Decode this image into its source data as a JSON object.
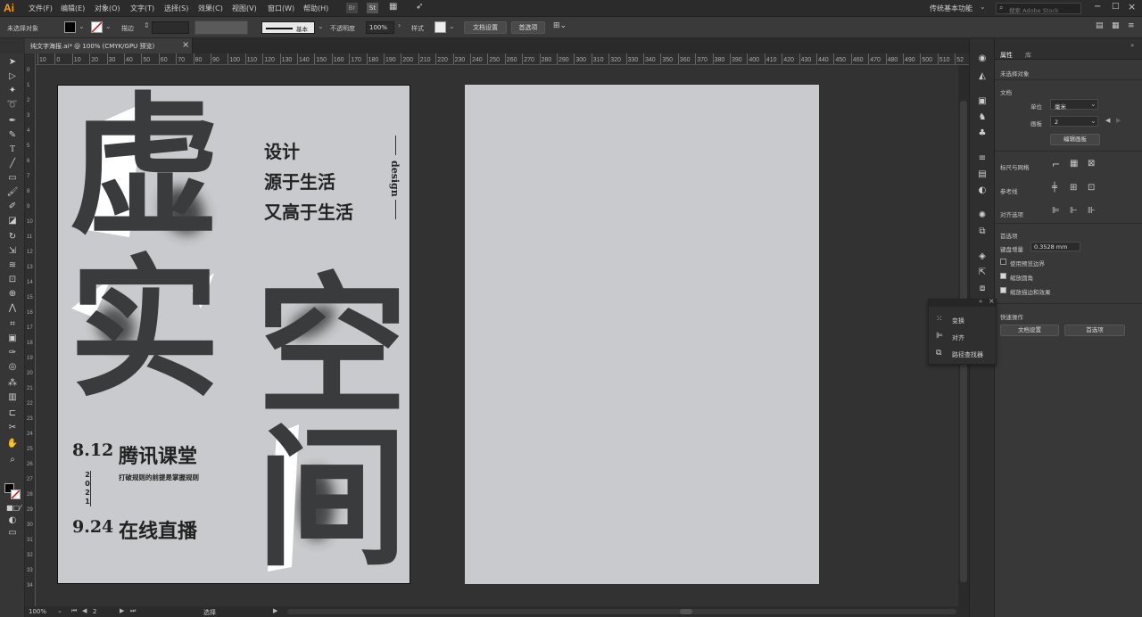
{
  "menubar": {
    "logo": "Ai",
    "items": [
      "文件(F)",
      "编辑(E)",
      "对象(O)",
      "文字(T)",
      "选择(S)",
      "效果(C)",
      "视图(V)",
      "窗口(W)",
      "帮助(H)"
    ],
    "workspace": "传统基本功能",
    "search_placeholder": "搜索 Adobe Stock"
  },
  "control": {
    "no_selection": "未选择对象",
    "stroke_label": "描边",
    "stroke_style": "基本",
    "opacity_label": "不透明度",
    "opacity_value": "100%",
    "style_label": "样式",
    "doc_setup": "文档设置",
    "prefs": "首选项"
  },
  "tab": {
    "title": "纯文字海报.ai* @ 100% (CMYK/GPU 预览)",
    "close": "×"
  },
  "ruler": {
    "h": [
      "10",
      "0",
      "10",
      "20",
      "30",
      "40",
      "50",
      "60",
      "70",
      "80",
      "90",
      "100",
      "110",
      "120",
      "130",
      "140",
      "150",
      "160",
      "170",
      "180",
      "190",
      "200",
      "210",
      "220",
      "230",
      "240",
      "250",
      "260",
      "270",
      "280",
      "290",
      "300",
      "310",
      "320",
      "330",
      "340",
      "350",
      "360",
      "370",
      "380",
      "390",
      "400",
      "410",
      "420",
      "430",
      "440",
      "450",
      "460",
      "470",
      "480",
      "490",
      "500",
      "510",
      "52"
    ],
    "v": [
      "0",
      "1",
      "2",
      "3",
      "4",
      "5",
      "6",
      "7",
      "8",
      "9",
      "10",
      "11",
      "12",
      "13",
      "14",
      "15",
      "16",
      "17",
      "18",
      "19",
      "20",
      "21",
      "22",
      "23",
      "24",
      "25",
      "26",
      "27",
      "28",
      "29",
      "30",
      "31",
      "32",
      "33",
      "34"
    ]
  },
  "poster": {
    "c1": "虚",
    "c2": "实",
    "c3": "空",
    "c4": "间",
    "tag1": "设计",
    "tag2": "源于生活",
    "tag3": "又高于生活",
    "design": "design",
    "date1": "8.12",
    "year": "2021",
    "date2": "9.24",
    "title": "腾讯课堂",
    "subtitle": "打破规则的前提是掌握规则",
    "live": "在线直播"
  },
  "status": {
    "zoom": "100%",
    "page": "2",
    "tool": "选择"
  },
  "props": {
    "tab1": "属性",
    "tab2": "库",
    "no_sel": "未选择对象",
    "doc": "文档",
    "unit_label": "单位",
    "unit_value": "毫米",
    "artboard_label": "画板",
    "artboard_value": "2",
    "edit_artboards": "编辑画板",
    "rulers_grids": "标尺与网格",
    "guides": "参考线",
    "align_opts": "对齐选项",
    "prefs": "首选项",
    "kbd_inc_label": "键盘增量",
    "kbd_inc_value": "0.3528 mm",
    "opt1": "使用预览边界",
    "opt2": "缩放圆角",
    "opt3": "缩放描边和效果",
    "quick": "快速操作",
    "btn_doc": "文档设置",
    "btn_pref": "首选项"
  },
  "floatpanel": {
    "items": [
      "变换",
      "对齐",
      "路径查找器"
    ]
  }
}
